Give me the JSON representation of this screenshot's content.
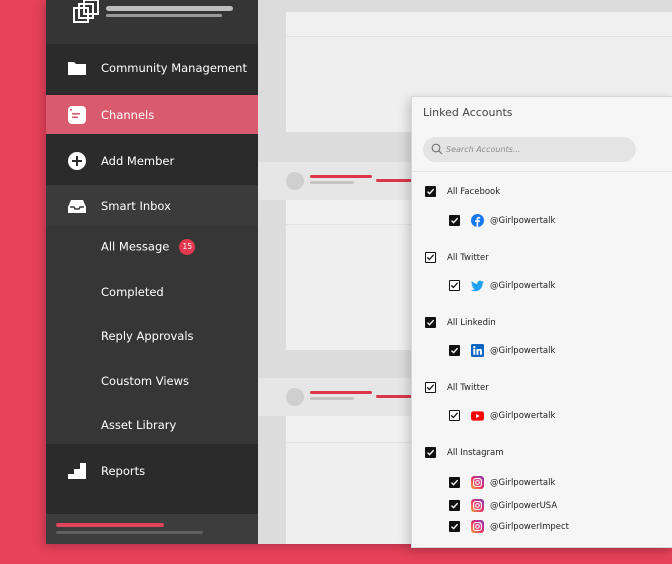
{
  "colors": {
    "page_background": "#e8415a",
    "sidebar": "#2b2b2b",
    "active_item": "#d85a6c",
    "badge": "#e2394f",
    "accent_line": "#d9384b"
  },
  "sidebar": {
    "logo_icon": "overlapping-squares-logo",
    "items": [
      {
        "label": "Community Management",
        "icon": "folder-icon"
      },
      {
        "label": "Channels",
        "icon": "channels-icon",
        "active": true
      },
      {
        "label": "Add Member",
        "icon": "plus-circle-icon"
      },
      {
        "label": "Smart Inbox",
        "icon": "inbox-icon"
      }
    ],
    "sub_items": [
      {
        "label": "All Message",
        "badge": "15"
      },
      {
        "label": "Completed"
      },
      {
        "label": "Reply Approvals"
      },
      {
        "label": "Coustom Views"
      },
      {
        "label": "Asset Library"
      }
    ],
    "reports": {
      "label": "Reports",
      "icon": "stairs-icon"
    }
  },
  "panel": {
    "title": "Linked Accounts",
    "search_placeholder": "Search Accounts...",
    "groups": [
      {
        "label": "All Facebook",
        "checkbox": "filled",
        "accounts": [
          {
            "handle": "@Girlpowertalk",
            "network": "facebook-icon",
            "checkbox": "filled"
          }
        ]
      },
      {
        "label": "All Twitter",
        "checkbox": "outline",
        "accounts": [
          {
            "handle": "@Girlpowertalk",
            "network": "twitter-icon",
            "checkbox": "outline"
          }
        ]
      },
      {
        "label": "All Linkedin",
        "checkbox": "filled",
        "accounts": [
          {
            "handle": "@Girlpowertalk",
            "network": "linkedin-icon",
            "checkbox": "filled"
          }
        ]
      },
      {
        "label": "All Twitter",
        "checkbox": "outline",
        "accounts": [
          {
            "handle": "@Girlpowertalk",
            "network": "youtube-icon",
            "checkbox": "outline"
          }
        ]
      },
      {
        "label": "All Instagram",
        "checkbox": "filled",
        "accounts": [
          {
            "handle": "@Girlpowertalk",
            "network": "instagram-icon",
            "checkbox": "filled"
          },
          {
            "handle": "@GirlpowerUSA",
            "network": "instagram-icon",
            "checkbox": "filled"
          },
          {
            "handle": "@GirlpowerImpect",
            "network": "instagram-icon",
            "checkbox": "filled"
          }
        ]
      }
    ]
  }
}
